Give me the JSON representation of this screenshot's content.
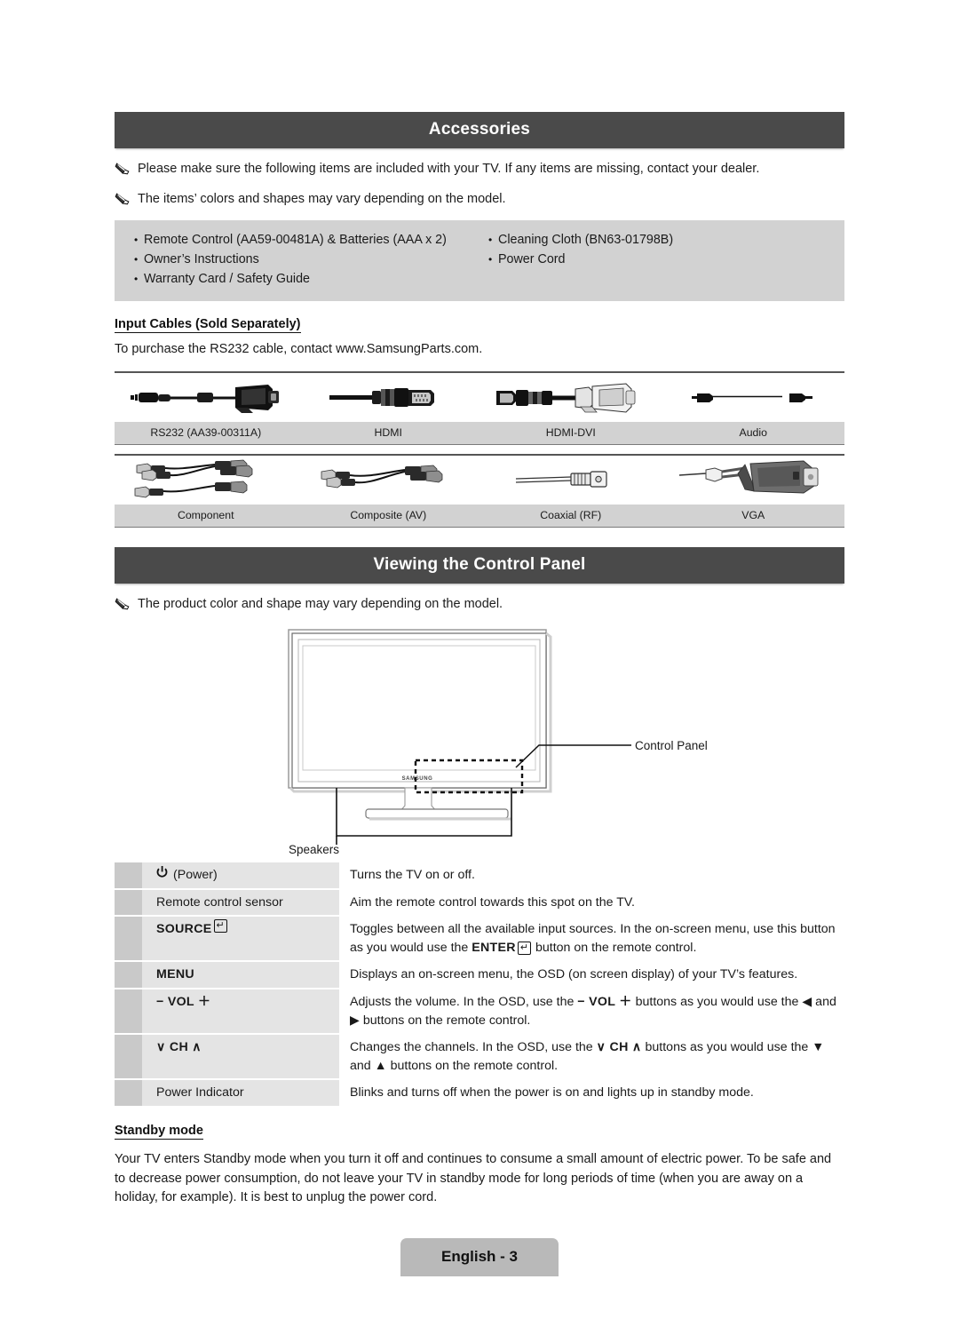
{
  "sections": {
    "accessories": {
      "title": "Accessories",
      "notes": [
        "Please make sure the following items are included with your TV. If any items are missing, contact your dealer.",
        "The items’ colors and shapes may vary depending on the model."
      ],
      "items_left": [
        "Remote Control (AA59-00481A) & Batteries (AAA x 2)",
        "Owner’s Instructions",
        "Warranty Card / Safety Guide"
      ],
      "items_right": [
        "Cleaning Cloth (BN63-01798B)",
        "Power Cord"
      ],
      "input_cables_heading": "Input Cables (Sold Separately)",
      "input_cables_note": "To purchase the RS232 cable, contact www.SamsungParts.com.",
      "cables_row1": [
        {
          "label": "RS232 (AA39-00311A)",
          "icon": "rs232-cable-icon"
        },
        {
          "label": "HDMI",
          "icon": "hdmi-cable-icon"
        },
        {
          "label": "HDMI-DVI",
          "icon": "hdmi-dvi-cable-icon"
        },
        {
          "label": "Audio",
          "icon": "audio-cable-icon"
        }
      ],
      "cables_row2": [
        {
          "label": "Component",
          "icon": "component-cable-icon"
        },
        {
          "label": "Composite (AV)",
          "icon": "composite-cable-icon"
        },
        {
          "label": "Coaxial (RF)",
          "icon": "coaxial-cable-icon"
        },
        {
          "label": "VGA",
          "icon": "vga-cable-icon"
        }
      ]
    },
    "control_panel": {
      "title": "Viewing the Control Panel",
      "note": "The product color and shape may vary depending on the model.",
      "diagram": {
        "brand": "SAMSUNG",
        "callout_control_panel": "Control Panel",
        "callout_speakers": "Speakers"
      },
      "rows": [
        {
          "key_prefix": "",
          "key": "(Power)",
          "key_icon": "power-icon",
          "desc": "Turns the TV on or off."
        },
        {
          "key": "Remote control sensor",
          "desc": "Aim the remote control towards this spot on the TV."
        },
        {
          "key": "SOURCE",
          "key_icon": "enter-key-icon",
          "desc_a": "Toggles between all the available input sources. In the on-screen menu, use this button as you would use the ",
          "desc_b": "ENTER",
          "desc_c": " button on the remote control."
        },
        {
          "key": "MENU",
          "desc": "Displays an on-screen menu, the OSD (on screen display) of your TV’s features."
        },
        {
          "key": "− VOL ＋",
          "desc_a": "Adjusts the volume. In the OSD, use the ",
          "desc_b": "− VOL ＋",
          "desc_c": " buttons as you would use the ◀ and ▶ buttons on the remote control."
        },
        {
          "key": "∨ CH ∧",
          "desc_a": "Changes the channels. In the OSD, use the ",
          "desc_b": "∨ CH ∧",
          "desc_c": " buttons as you would use the ▼ and ▲ buttons on the remote control."
        },
        {
          "key": "Power Indicator",
          "desc": "Blinks and turns off when the power is on and lights up in standby mode."
        }
      ],
      "standby_heading": "Standby mode",
      "standby_text": "Your TV enters Standby mode when you turn it off and continues to consume a small amount of electric power. To be safe and to decrease power consumption, do not leave your TV in standby mode for long periods of time (when you are away on a holiday, for example). It is best to unplug the power cord."
    }
  },
  "footer": {
    "page_label": "English - 3"
  },
  "colors": {
    "header_bar": "#4a4a4a",
    "accessory_box": "#d2d2d2",
    "table_band": "#e4e4e4",
    "swatch": "#c9c9c9",
    "footer_badge": "#b9b9b9"
  }
}
